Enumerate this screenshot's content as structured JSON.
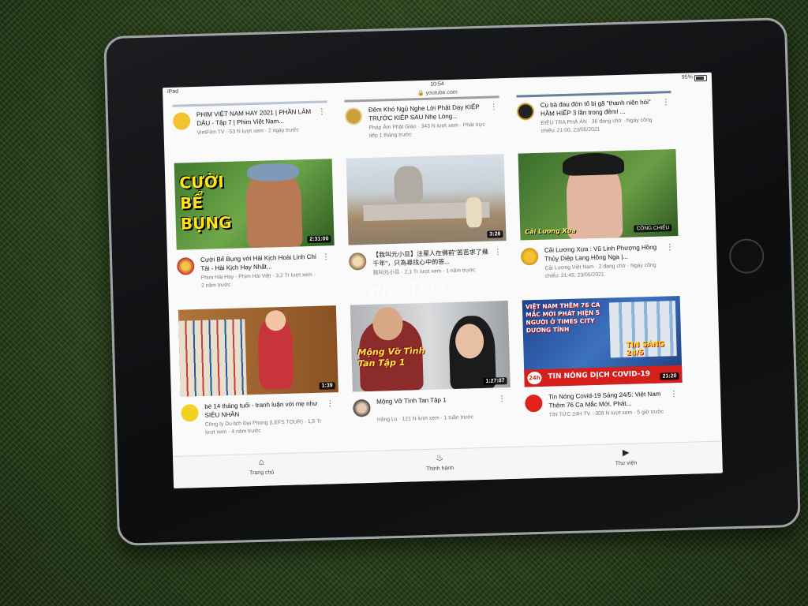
{
  "status_bar": {
    "device": "iPad",
    "time": "10:54",
    "battery": "95%"
  },
  "address_bar": {
    "url": "youtube.com"
  },
  "row1": [
    {
      "title": "PHIM VIỆT NAM HAY 2021 | PHẦN LÀM DÂU - Tập 7 | Phim Việt Nam...",
      "channel": "VietFilm TV · 53 N lượt xem · 2 ngày trước"
    },
    {
      "title": "Đêm Khó Ngủ Nghe Lời Phật Dạy KIẾP TRƯỚC KIẾP SAU Nhẹ Lòng...",
      "channel": "Pháp Âm Phật Giáo · 343 N lượt xem · Phát trực tiếp 1 tháng trước"
    },
    {
      "title": "Cụ bà đau đớn tố bị gã \"thanh niên hói\" HÃM HIẾP 3 lần trong đêm! ...",
      "channel": "ĐIỀU TRA PHÁ ÁN · 36 đang chờ · Ngày công chiếu: 21:00, 23/05/2021"
    }
  ],
  "row2": [
    {
      "title": "Cười Bể Bụng với Hài Kịch Hoài Linh Chí Tài - Hài Kịch Hay Nhất...",
      "channel": "Phim Hài Hay - Phim Hài Việt · 3,2 Tr lượt xem · 2 năm trước",
      "duration": "2:31:00",
      "thumb_text": "CƯỜI BỂ BỤNG"
    },
    {
      "title": "【我叫元小旦】注星人在佛前\"苦苦求了幾千年\"，只為尋找心中的答...",
      "channel": "我叫元小旦 · 2,1 Tr lượt xem · 1 năm trước",
      "duration": "3:28"
    },
    {
      "title": "Cải Lương Xưa : Vũ Linh Phượng Hồng Thủy Diệp Lang Hồng Nga |...",
      "channel": "Cải Lương Việt Nam · 2 đang chờ · Ngày công chiếu: 21:45, 23/05/2021",
      "thumb_badge": "CÔNG CHIẾU",
      "thumb_label": "Cải Lương Xưa"
    }
  ],
  "row3": [
    {
      "title": "bé 14 tháng tuổi - tranh luận với mẹ như SIÊU NHÂN",
      "channel": "Công ty Du lịch Đại Phong (LEFS TOUR) · 1,5 Tr lượt xem · 4 năm trước",
      "duration": "1:39"
    },
    {
      "title": "Mộng Vỡ Tình Tan Tập 1",
      "channel": "Hằng Lu · 121 N lượt xem · 1 tuần trước",
      "duration": "1:27:07",
      "thumb_text": "Mộng Vỡ Tình Tan Tập 1"
    },
    {
      "title": "Tin Nóng Covid-19 Sáng 24/5: Việt Nam Thêm 76 Ca Mắc Mới, Phát...",
      "channel": "TIN TỨC 24H TV · 309 N lượt xem · 5 giờ trước",
      "duration": "21:20",
      "thumb_text": "VIỆT NAM THÊM 76 CA MẮC MỚI PHÁT HIỆN 5 NGƯỜI Ở TIMES CITY DƯƠNG TÍNH",
      "thumb_tag": "TIN SÁNG 24/5",
      "thumb_banner": "TIN NÓNG DỊCH COVID-19",
      "thumb_logo": "24h"
    }
  ],
  "bottom_nav": [
    {
      "label": "Trang chủ",
      "icon": "home-icon"
    },
    {
      "label": "Thịnh hành",
      "icon": "flame-icon"
    },
    {
      "label": "Thư viện",
      "icon": "library-icon"
    }
  ],
  "watermark": "chợTỐT",
  "colors": {
    "red": "#e0221b",
    "yellow": "#f7d21a"
  }
}
